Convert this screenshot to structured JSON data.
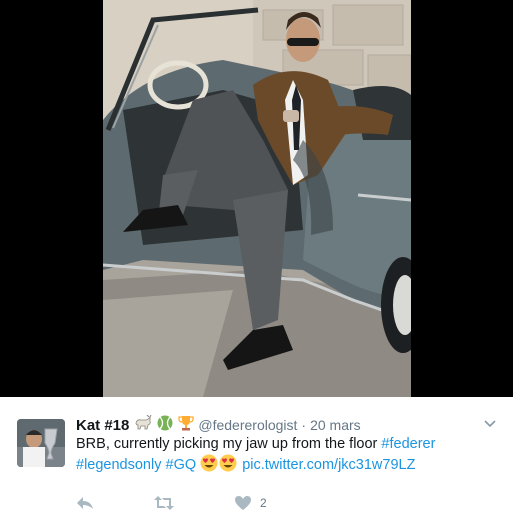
{
  "tweet": {
    "author_name": "Kat #18",
    "author_emojis": [
      "goat-emoji",
      "tennis-ball-emoji",
      "trophy-emoji"
    ],
    "handle": "@federerologist",
    "separator": "·",
    "timestamp": "20 mars",
    "text_part1": "BRB, currently picking my jaw up from the floor ",
    "hashtag1": "#federer",
    "hashtag2": "#legendsonly",
    "hashtag3": "#GQ",
    "link": "pic.twitter.com/jkc31w79LZ",
    "like_count": "2"
  },
  "colors": {
    "link": "#1b95e0",
    "muted": "#657786",
    "text": "#14171a",
    "media_bg": "#000000"
  },
  "icons": {
    "reply": "reply-icon",
    "retweet": "retweet-icon",
    "like": "heart-icon",
    "more": "chevron-down-icon"
  }
}
